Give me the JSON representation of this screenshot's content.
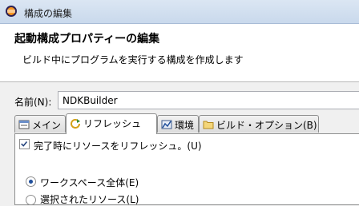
{
  "window": {
    "title": "構成の編集"
  },
  "header": {
    "heading": "起動構成プロパティーの編集",
    "description": "ビルド中にプログラムを実行する構成を作成します"
  },
  "name_field": {
    "label": "名前(N):",
    "value": "NDKBuilder"
  },
  "tabs": [
    {
      "label": "メイン",
      "icon": "main-tab-icon",
      "active": false
    },
    {
      "label": "リフレッシュ",
      "icon": "refresh-icon",
      "active": true
    },
    {
      "label": "環境",
      "icon": "environment-icon",
      "active": false
    },
    {
      "label": "ビルド・オプション(B)",
      "icon": "folder-icon",
      "active": false
    }
  ],
  "refresh": {
    "checkbox_label": "完了時にリソースをリフレッシュ。(U)",
    "checkbox_checked": true,
    "radios": [
      {
        "label": "ワークスペース全体(E)",
        "selected": true
      },
      {
        "label": "選択されたリソース(L)",
        "selected": false
      }
    ]
  }
}
